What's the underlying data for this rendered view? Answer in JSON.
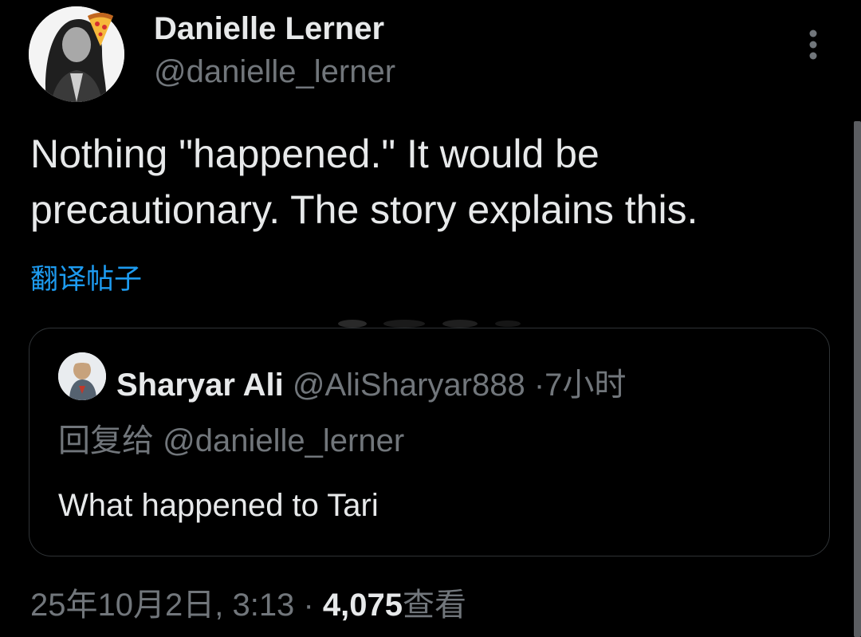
{
  "author": {
    "display_name": "Danielle Lerner",
    "handle": "@danielle_lerner",
    "avatar_icon": "profile-photo",
    "badge_icon": "pizza-emoji"
  },
  "tweet": {
    "text": "Nothing \"happened.\" It would be precautionary. The story explains this.",
    "translate_label": "翻译帖子"
  },
  "quoted_tweet": {
    "display_name": "Sharyar Ali",
    "handle": "@AliSharyar888",
    "separator": "·",
    "time": "7小时",
    "reply_prefix": "回复给",
    "reply_to": "@danielle_lerner",
    "text": "What happened to Tari"
  },
  "meta": {
    "timestamp": "25年10月2日, 3:13",
    "separator": "·",
    "views_count": "4,075",
    "views_label": "查看"
  },
  "colors": {
    "background": "#000000",
    "text": "#e7e9ea",
    "secondary": "#71767b",
    "accent": "#1d9bf0",
    "border": "#2f3336"
  }
}
